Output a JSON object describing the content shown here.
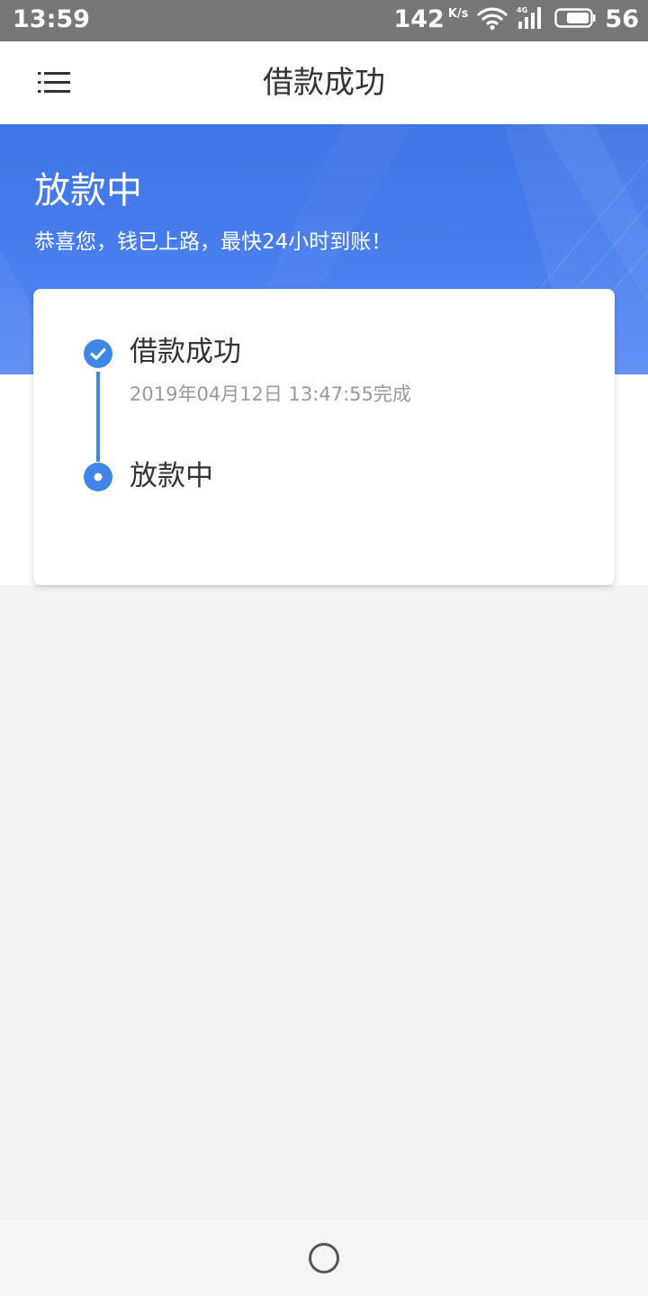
{
  "status_bar": {
    "time": "13:59",
    "net_speed": "142",
    "net_speed_unit": "K/s",
    "battery_level": "56",
    "icons": [
      "wifi-icon",
      "signal-4g-icon",
      "battery-icon"
    ]
  },
  "navbar": {
    "title": "借款成功",
    "menu_icon": "menu-icon"
  },
  "banner": {
    "title": "放款中",
    "subtitle": "恭喜您，钱已上路，最快24小时到账！"
  },
  "timeline": {
    "steps": [
      {
        "label": "借款成功",
        "time": "2019年04月12日 13:47:55完成",
        "status": "completed",
        "icon": "check-circle-icon"
      },
      {
        "label": "放款中",
        "status": "current",
        "icon": "dot-circle-icon"
      }
    ]
  },
  "colors": {
    "accent": "#3f86e8",
    "banner_blue": "#4a7ff0",
    "status_bar": "#777777",
    "page_background": "#f2f2f2"
  },
  "bottom_nav": {
    "home_icon": "home-circle-icon"
  }
}
